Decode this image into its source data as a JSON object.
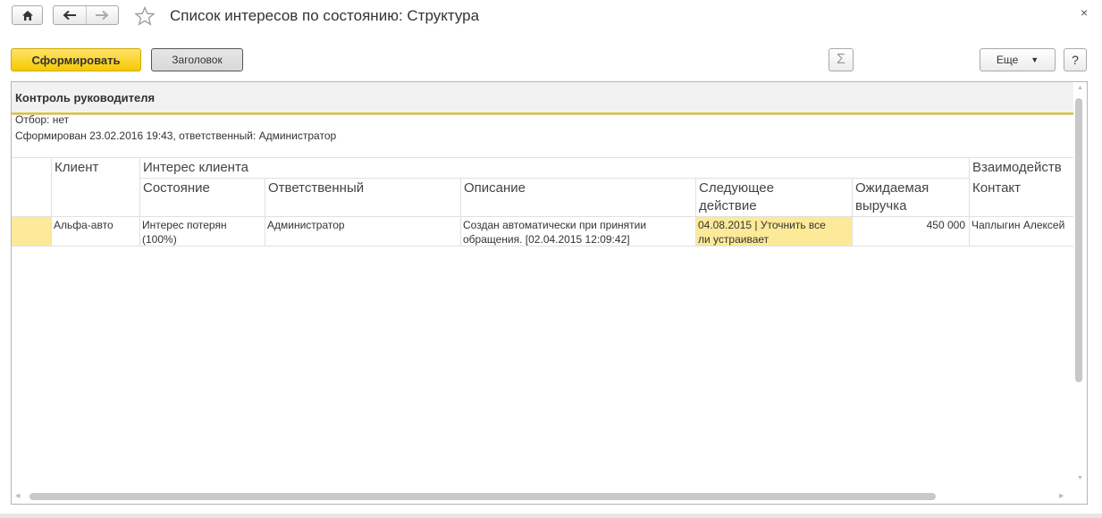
{
  "window": {
    "title": "Список интересов по состоянию: Структура",
    "close": "×",
    "home_icon": "home-icon",
    "back_icon": "arrow-left-icon",
    "forward_icon": "arrow-right-icon",
    "favorite_icon": "star-icon"
  },
  "toolbar": {
    "generate_label": "Сформировать",
    "header_label": "Заголовок",
    "sum_label": "Σ",
    "more_label": "Еще",
    "help_label": "?"
  },
  "report": {
    "title": "Контроль руководителя",
    "filter_line": "Отбор: нет",
    "formed_line": "Сформирован 23.02.2016 19:43, ответственный: Администратор",
    "group_headers": {
      "client": "Клиент",
      "interest": "Интерес клиента",
      "interaction": "Взаимодейств"
    },
    "columns": {
      "state": "Состояние",
      "responsible": "Ответственный",
      "description": "Описание",
      "next_action_1": "Следующее",
      "next_action_2": "действие",
      "revenue_1": "Ожидаемая",
      "revenue_2": "выручка",
      "contact": "Контакт"
    },
    "rows": [
      {
        "client": "Альфа-авто",
        "state_1": "Интерес потерян",
        "state_2": "(100%)",
        "responsible": "Администратор",
        "description_1": "Создан автоматически при принятии",
        "description_2": "обращения. [02.04.2015 12:09:42]",
        "next_action_1": "04.08.2015 | Уточнить все",
        "next_action_2": "ли устраивает",
        "revenue": "450 000",
        "contact": "Чаплыгин Алексей"
      }
    ]
  },
  "colors": {
    "accent_yellow": "#f5c900",
    "highlight_cell": "#fcea98"
  }
}
